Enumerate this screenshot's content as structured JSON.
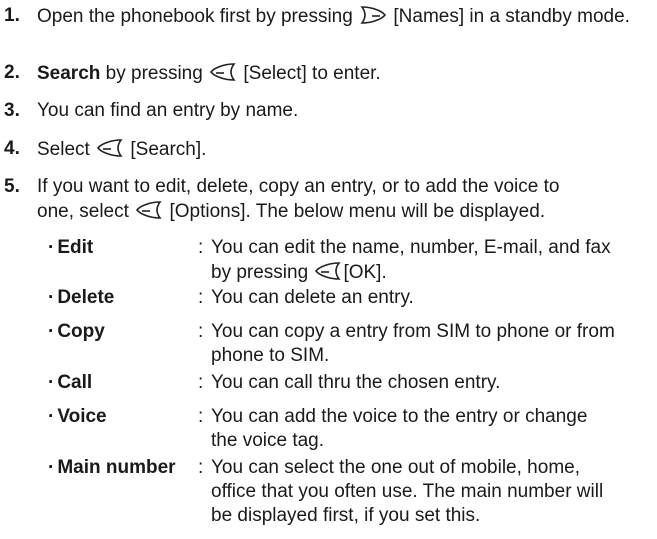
{
  "steps": [
    {
      "num": "1.",
      "pre": "Open the phonebook first by pressing",
      "key": "right-soft-key-icon",
      "post": "[Names] in a standby mode."
    },
    {
      "num": "2.",
      "bold": "Search",
      "pre": "by pressing",
      "key": "left-soft-key-icon",
      "post": "[Select] to enter."
    },
    {
      "num": "3.",
      "text": "You can find an entry by name."
    },
    {
      "num": "4.",
      "pre": "Select",
      "key": "left-soft-key-icon",
      "post": "[Search]."
    },
    {
      "num": "5.",
      "text_line1": "If you want to edit, delete, copy an entry, or to add the voice to",
      "text_line2_pre": "one, select",
      "key": "left-soft-key-icon",
      "text_line2_post": "[Options]. The below menu will be displayed."
    }
  ],
  "options": [
    {
      "name": "Edit",
      "desc_line1": "You can edit the name, number, E-mail, and fax",
      "desc_line2_pre": "by pressing",
      "key": "left-soft-key-icon",
      "desc_line2_post": "[OK]."
    },
    {
      "name": "Delete",
      "desc": "You can delete an entry."
    },
    {
      "name": "Copy",
      "desc_line1": "You can copy a entry from SIM to phone or from",
      "desc_line2": "phone to SIM."
    },
    {
      "name": "Call",
      "desc": "You can call thru the chosen entry."
    },
    {
      "name": "Voice",
      "desc_line1": "You can add the voice to the entry or change",
      "desc_line2": "the voice tag."
    },
    {
      "name": "Main number",
      "desc_line1": "You can select the one out of mobile, home,",
      "desc_line2": "office that you often use. The main number will",
      "desc_line3": "be displayed first, if you set this."
    }
  ],
  "bullet": "·",
  "colon": ":"
}
